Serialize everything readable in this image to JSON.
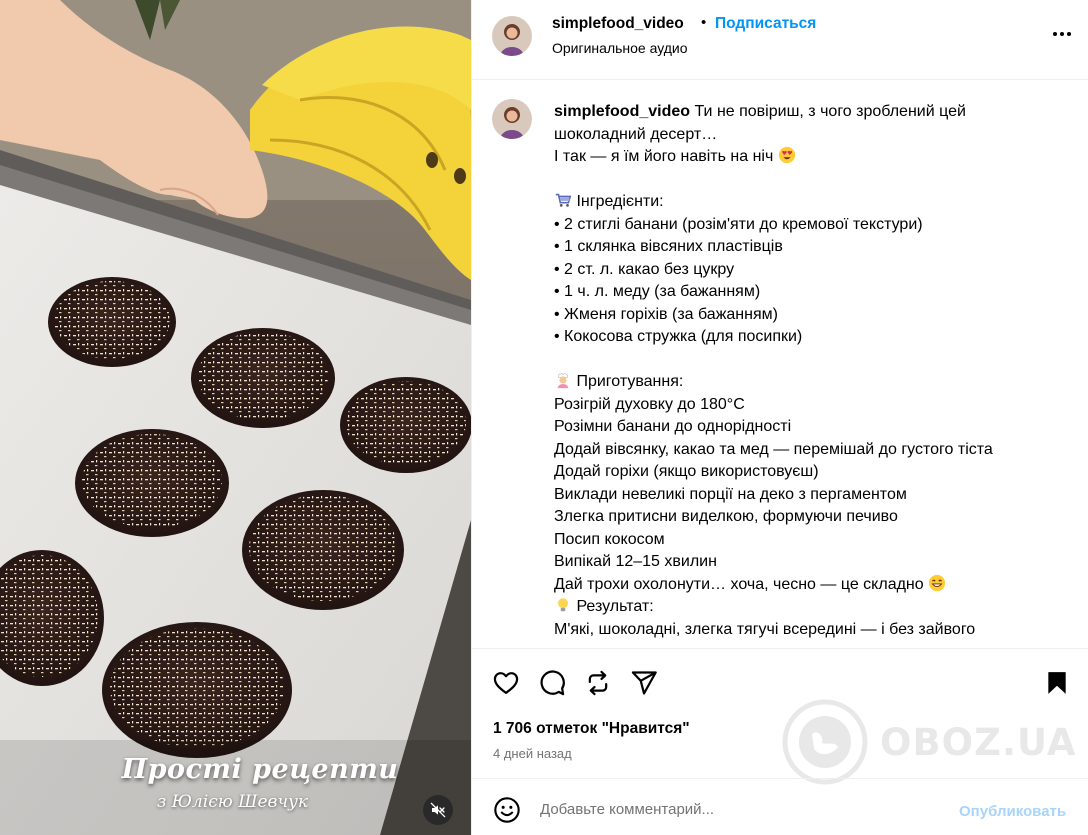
{
  "post": {
    "username": "simplefood_video",
    "follow_label": "Подписаться",
    "separator": "•",
    "audio_label": "Оригинальное аудио"
  },
  "caption": {
    "username": "simplefood_video",
    "lines": [
      "Ти не повіриш, з чого зроблений цей",
      "шоколадний десерт…",
      "І так — я їм його навіть на ніч",
      "",
      "Інгредієнти:",
      "• 2 стиглі банани (розім'яти до кремової текстури)",
      "• 1 склянка вівсяних пластівців",
      "• 2 ст. л. какао без цукру",
      "• 1 ч. л. меду (за бажанням)",
      "• Жменя горіхів (за бажанням)",
      "• Кокосова стружка (для посипки)",
      "",
      "Приготування:",
      "Розігрій духовку до 180°C",
      "Розімни банани до однорідності",
      "Додай вівсянку, какао та мед — перемішай до густого тіста",
      "Додай горіхи (якщо використовуєш)",
      "Виклади невеликі порції на деко з пергаментом",
      "Злегка притисни виделкою, формуючи печиво",
      "Посип кокосом",
      "Випікай 12–15 хвилин",
      "Дай трохи охолонути… хоча, чесно — це складно",
      "Результат:",
      "М'які, шоколадні, злегка тягучі всередині — і без зайвого"
    ]
  },
  "icons": {
    "like": "heart-icon",
    "comment": "comment-icon",
    "repost": "repost-icon",
    "share": "share-icon",
    "save": "bookmark-icon",
    "emoji": "smiley-icon",
    "mute": "muted-speaker-icon",
    "more": "more-icon"
  },
  "stats": {
    "likes": "1 706 отметок \"Нравится\"",
    "time_ago": "4 дней назад"
  },
  "comment": {
    "placeholder": "Добавьте комментарий...",
    "post_label": "Опубликовать"
  },
  "video": {
    "overlay_title": "Прості рецепти",
    "overlay_subtitle": "з Юлією Шевчук"
  },
  "watermark": {
    "text": "OBOZ.UA"
  },
  "colors": {
    "accent": "#0095f6",
    "post_disabled": "#a8d4fb",
    "secondary_text": "#737373"
  }
}
